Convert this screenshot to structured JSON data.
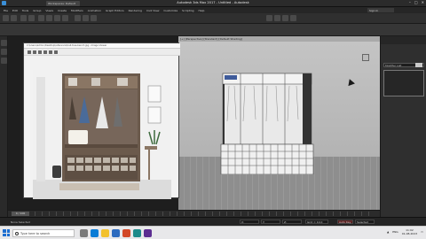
{
  "window": {
    "title": "Autodesk 3ds Max 2017 - Untitled - Autodesk",
    "doc_tab": "Workspaces: Default"
  },
  "menu": [
    "File",
    "Edit",
    "Tools",
    "Group",
    "Views",
    "Create",
    "Modifiers",
    "Animation",
    "Graph Editors",
    "Rendering",
    "Civil View",
    "Customize",
    "Scripting",
    "Help"
  ],
  "signin": "Sign In",
  "reference_window": {
    "title": "C:\\Users\\admin\\Desktop\\reference\\hall-tree-bench.jpg - Image Viewer"
  },
  "viewport": {
    "label": "[+] [Perspective] [Standard] [Default Shading]"
  },
  "command_panel": {
    "field": "Modifier List"
  },
  "timeslider": {
    "thumb": "0 / 100"
  },
  "status": {
    "selected": "None Selected",
    "x": "X:",
    "y": "Y:",
    "z": "Z:",
    "grid": "Grid = 10.0",
    "autokey": "Auto Key",
    "selected_dropdown": "Selected"
  },
  "taskbar": {
    "search_placeholder": "Type here to search",
    "time": "11:02",
    "date": "01-08-2023",
    "lang": "ENG"
  },
  "colors": {
    "accent": "#1e6fd1"
  }
}
